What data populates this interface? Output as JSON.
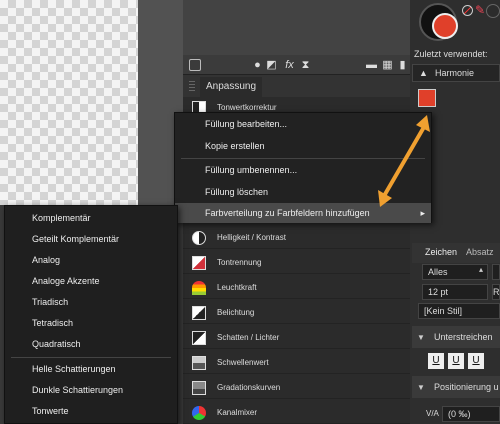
{
  "layers_panel": {
    "tab": "Anpassung",
    "toolbar_icons": [
      "layer-stack-icon",
      "circle-mask-icon",
      "pixel-layer-icon",
      "fx-icon",
      "hourglass-icon",
      "folder-icon",
      "grid-icon",
      "trash-icon"
    ],
    "adjustments": [
      {
        "label": "Tonwertkorrektur",
        "icon": "levels-icon"
      },
      {
        "label": "Helligkeit / Kontrast",
        "icon": "brightness-contrast-icon"
      },
      {
        "label": "Tontrennung",
        "icon": "posterize-icon"
      },
      {
        "label": "Leuchtkraft",
        "icon": "vibrance-icon"
      },
      {
        "label": "Belichtung",
        "icon": "exposure-icon"
      },
      {
        "label": "Schatten / Lichter",
        "icon": "shadows-highlights-icon"
      },
      {
        "label": "Schwellenwert",
        "icon": "threshold-icon"
      },
      {
        "label": "Gradationskurven",
        "icon": "curves-icon"
      },
      {
        "label": "Kanalmixer",
        "icon": "channel-mixer-icon"
      }
    ]
  },
  "context_menu": {
    "items": [
      "Füllung bearbeiten...",
      "Kopie erstellen",
      "Füllung umbenennen...",
      "Füllung löschen",
      "Farbverteilung zu Farbfeldern hinzufügen"
    ],
    "submenu_arrow": "▸"
  },
  "submenu": {
    "items": [
      "Komplementär",
      "Geteilt Komplementär",
      "Analog",
      "Analoge Akzente",
      "Triadisch",
      "Tetradisch",
      "Quadratisch",
      "Helle Schattierungen",
      "Dunkle Schattierungen",
      "Tonwerte"
    ]
  },
  "right_panel": {
    "recent_label": "Zuletzt verwendet:",
    "harmony_label": "Harmonie",
    "recent_swatch_color": "#e0402a",
    "fill_color": "#e0402a",
    "tabs": [
      "Zeichen",
      "Absatz"
    ],
    "font_field": "Alles",
    "size_field": "12 pt",
    "size_unit": "R",
    "style_field": "[Kein Stil]",
    "underline_section": "Unterstreichen",
    "underline_buttons": [
      "U",
      "U",
      "U"
    ],
    "position_section": "Positionierung u",
    "tracking_icon": "V/A",
    "tracking_value": "(0 ‰)"
  },
  "accent_color": "#f0a030"
}
